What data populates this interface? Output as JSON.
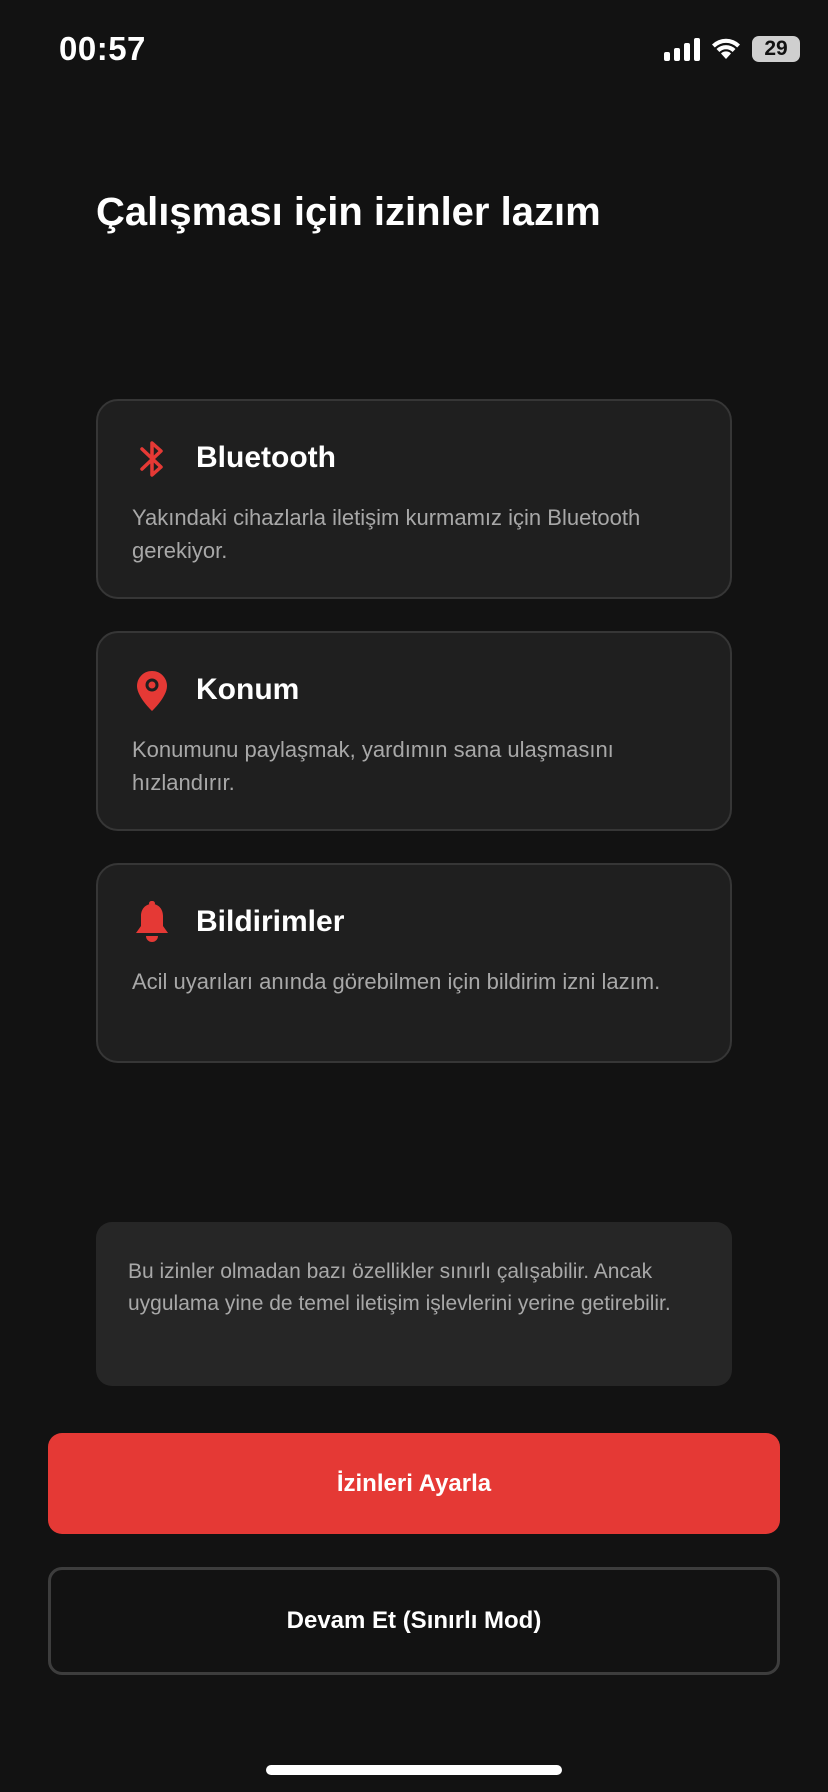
{
  "status_bar": {
    "time": "00:57",
    "battery_level": "29",
    "icons": [
      "signal-icon",
      "wifi-icon",
      "battery-icon"
    ]
  },
  "page": {
    "title": "Çalışması için izinler lazım"
  },
  "permissions": [
    {
      "icon": "bluetooth-icon",
      "title": "Bluetooth",
      "description": "Yakındaki cihazlarla iletişim kurmamız için Bluetooth gerekiyor."
    },
    {
      "icon": "location-pin-icon",
      "title": "Konum",
      "description": "Konumunu paylaşmak, yardımın sana ulaşmasını hızlandırır."
    },
    {
      "icon": "bell-icon",
      "title": "Bildirimler",
      "description": "Acil uyarıları anında görebilmen için bildirim izni lazım."
    }
  ],
  "info_note": "Bu izinler olmadan bazı özellikler sınırlı çalışabilir. Ancak uygulama yine de temel iletişim işlevlerini yerine getirebilir.",
  "buttons": {
    "primary_label": "İzinleri Ayarla",
    "secondary_label": "Devam Et (Sınırlı Mod)"
  },
  "colors": {
    "background": "#121212",
    "card": "#1f1f1f",
    "accent": "#e53935",
    "text_secondary": "#a8a8a8"
  }
}
